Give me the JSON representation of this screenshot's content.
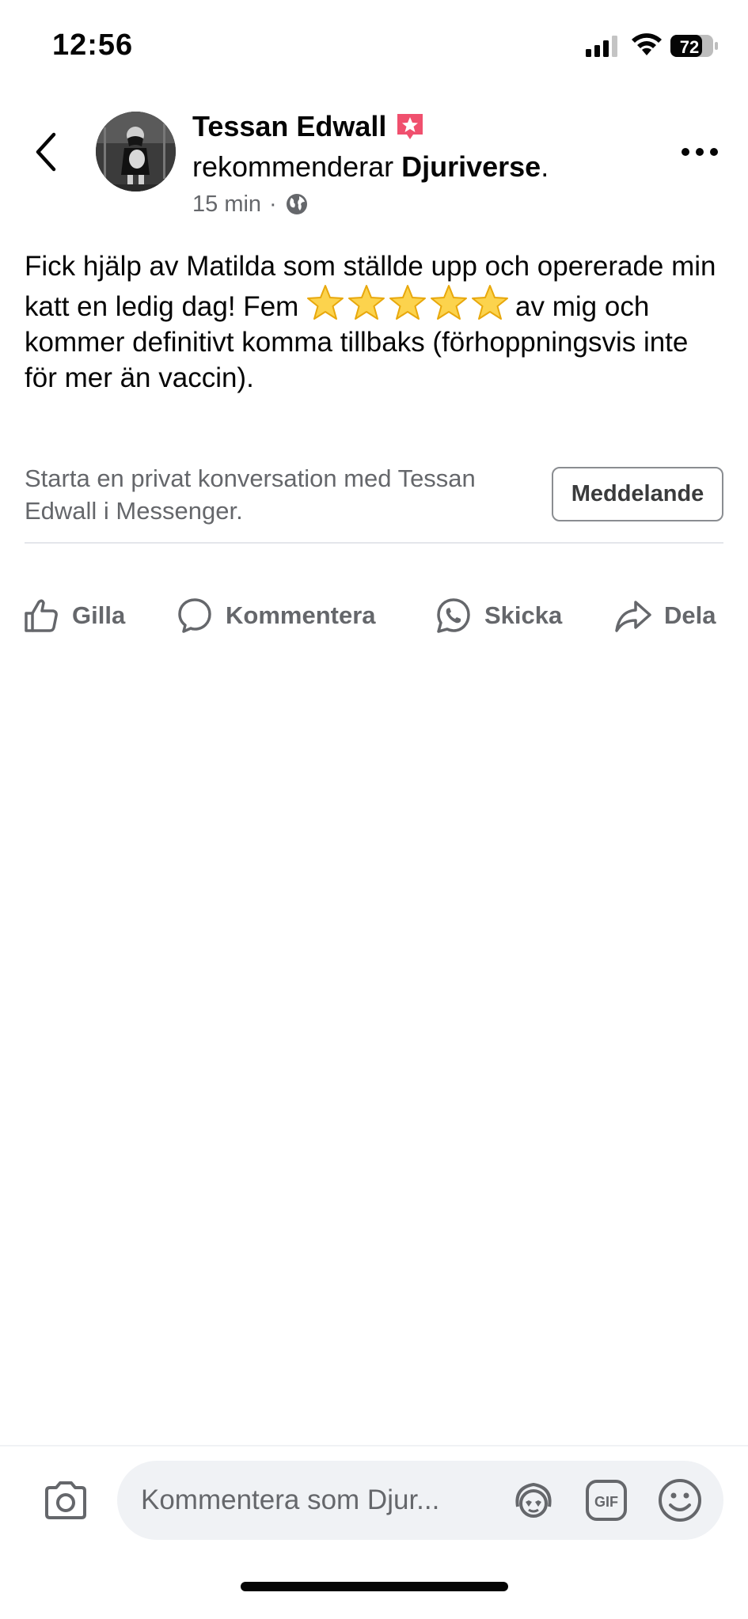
{
  "status_bar": {
    "time": "12:56",
    "battery_level": "72"
  },
  "post": {
    "author_name": "Tessan Edwall",
    "recommends_prefix": "rekommenderar",
    "page_name": "Djuriverse",
    "recommends_suffix": ".",
    "time_ago": "15 min",
    "separator": "·",
    "text_part1": "Fick hjälp av Matilda som ställde upp och opererade min katt en ledig dag! Fem",
    "star_rating": 5,
    "text_part2": "av mig och kommer definitivt komma tillbaks (förhoppningsvis inte för mer än vaccin).",
    "badge_color": "#f0506e"
  },
  "messenger": {
    "prompt": "Starta en privat konversation med Tessan Edwall i Messenger.",
    "button_label": "Meddelande"
  },
  "actions": {
    "like": "Gilla",
    "comment": "Kommentera",
    "send": "Skicka",
    "share": "Dela"
  },
  "comment_bar": {
    "placeholder": "Kommentera som Djur..."
  }
}
